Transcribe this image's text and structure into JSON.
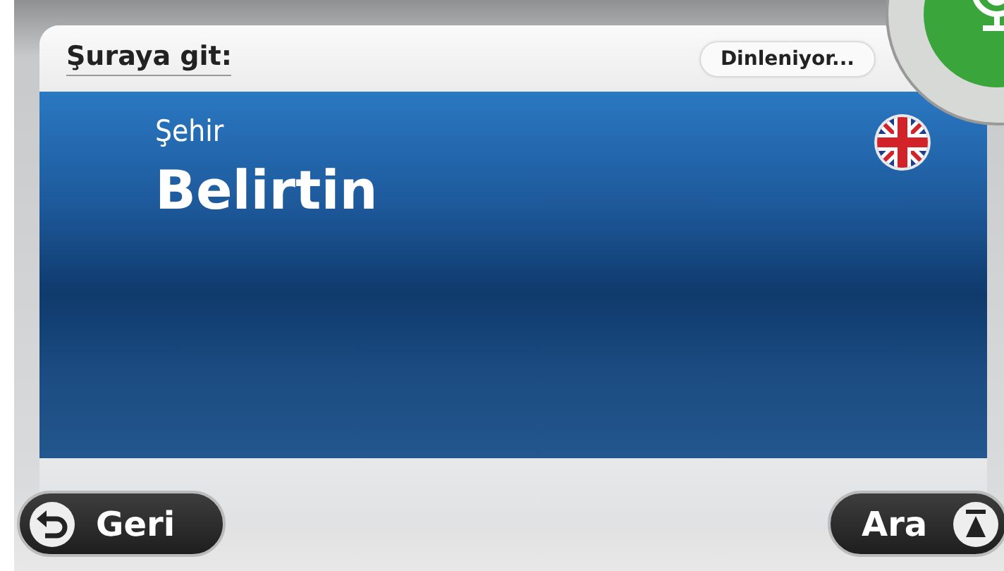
{
  "header": {
    "title": "Şuraya git:",
    "status": "Dinleniyor..."
  },
  "entry": {
    "label": "Şehir",
    "value": "Belirtin"
  },
  "buttons": [
    {
      "kind": "back",
      "label": "Geri"
    },
    {
      "kind": "search",
      "label": "Ara"
    }
  ]
}
